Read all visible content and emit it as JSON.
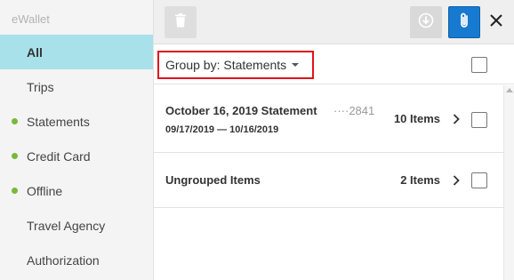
{
  "sidebar": {
    "title": "eWallet",
    "items": [
      {
        "label": "All",
        "active": true,
        "dot": false
      },
      {
        "label": "Trips",
        "active": false,
        "dot": false
      },
      {
        "label": "Statements",
        "active": false,
        "dot": true
      },
      {
        "label": "Credit Card",
        "active": false,
        "dot": true
      },
      {
        "label": "Offline",
        "active": false,
        "dot": true
      },
      {
        "label": "Travel Agency",
        "active": false,
        "dot": false
      },
      {
        "label": "Authorization",
        "active": false,
        "dot": false
      }
    ],
    "dot_color": "#7ab83d",
    "active_color": "#a9e1ea"
  },
  "toolbar": {
    "delete_icon": "trash-icon",
    "download_icon": "download-circle-icon",
    "attach_icon": "paperclip-icon",
    "close_icon": "close-icon",
    "attach_color": "#1779cf"
  },
  "group_by": {
    "label": "Group by: Statements",
    "highlight_color": "#e0121b"
  },
  "groups": [
    {
      "title": "October 16, 2019 Statement",
      "account": "····2841",
      "date_range": "09/17/2019 — 10/16/2019",
      "count": "10 Items"
    },
    {
      "title": "Ungrouped Items",
      "count": "2 Items"
    }
  ]
}
